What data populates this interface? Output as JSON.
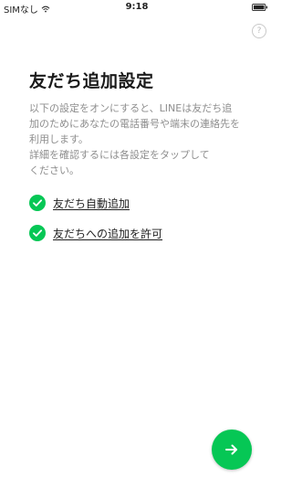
{
  "status_bar": {
    "carrier": "SIMなし",
    "time": "9:18"
  },
  "help": {
    "label": "?"
  },
  "page": {
    "title": "友だち追加設定",
    "description_lines": [
      "以下の設定をオンにすると、LINEは友だち追",
      "加のためにあなたの電話番号や端末の連絡先を",
      "利用します。",
      "詳細を確認するには各設定をタップして",
      "ください。"
    ]
  },
  "settings": [
    {
      "label": "友だち自動追加",
      "enabled": true
    },
    {
      "label": "友だちへの追加を許可",
      "enabled": true
    }
  ],
  "colors": {
    "accent": "#06c755",
    "title": "#1a1a1a",
    "description": "#8e8e8e"
  },
  "icons": {
    "next": "arrow-right-icon",
    "check": "check-circle-icon",
    "help": "help-circle-icon",
    "wifi": "wifi-icon",
    "battery": "battery-icon"
  }
}
